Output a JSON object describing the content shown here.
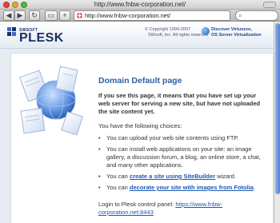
{
  "window": {
    "title": "http://www.fnbw-corporation.net/"
  },
  "toolbar": {
    "back_icon": "back-icon",
    "forward_icon": "forward-icon",
    "reload_icon": "reload-icon",
    "add_bookmark_icon": "add-bookmark-icon",
    "new_tab_icon": "plus-icon",
    "url": "http://www.fnbw-corporation.net/",
    "search_placeholder": ""
  },
  "header": {
    "logo_top": "SWSOFT",
    "logo_word": "PLESK",
    "copyright_line1": "© Copyright 1999-2007",
    "copyright_line2": "SWsoft, Inc. All rights reserved",
    "promo_line1": "Discover Virtuozzo,",
    "promo_line2": "OS Server Virtualization"
  },
  "page": {
    "heading": "Domain Default page",
    "intro": "If you see this page, it means that you have set up your web server for serving a new site, but have not uploaded the site content yet.",
    "choices_label": "You have the following choices:",
    "options": {
      "o1": "You can upload your web site contents using FTP.",
      "o2": "You can install web applications on your site: an image gallery, a discussion forum, a blog, an online store, a chat, and many other applications.",
      "o3_prefix": "You can ",
      "o3_link": "create a site using SiteBuilder",
      "o3_suffix": " wizard.",
      "o4_prefix": "You can ",
      "o4_link": "decorate your site with images from Fotolia",
      "o4_suffix": "."
    },
    "login_prefix": "Login to Plesk control panel: ",
    "login_link": "https://www.fnbw-corporation.net:8443"
  },
  "colors": {
    "accent": "#2d5fa3",
    "link": "#1d59b3",
    "brand": "#1a2f64",
    "background": "#e7ecf3"
  }
}
